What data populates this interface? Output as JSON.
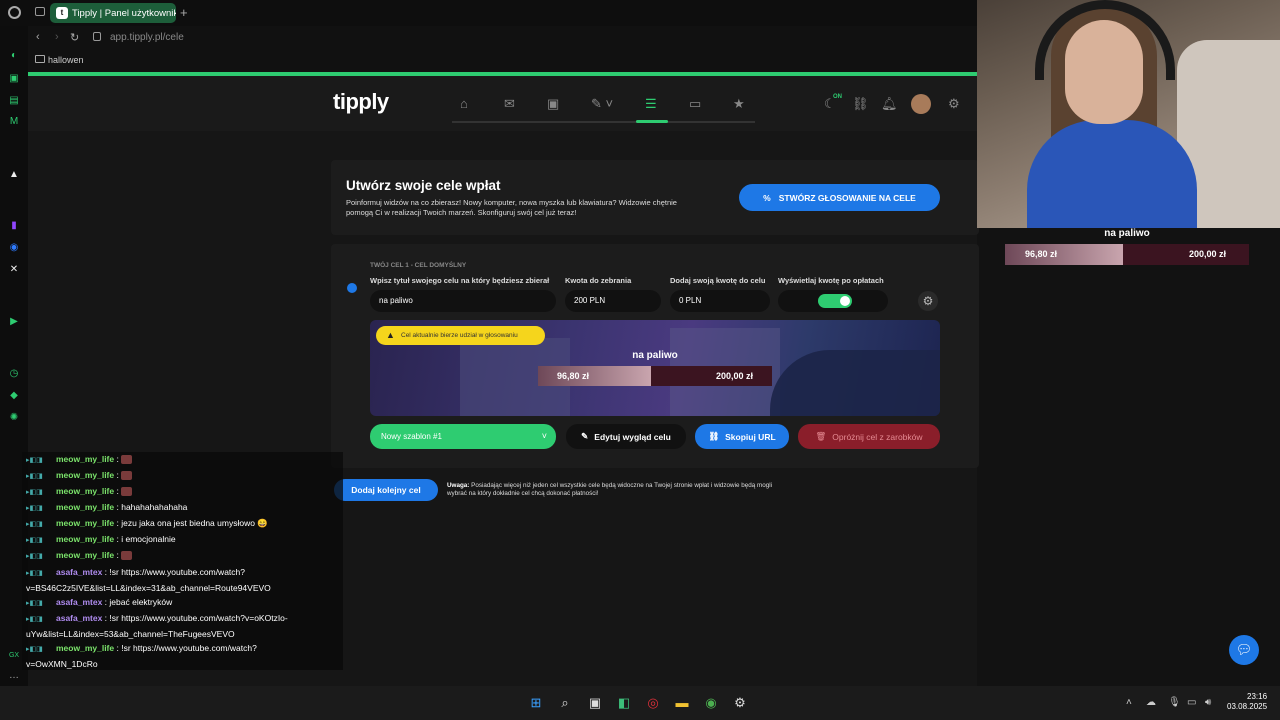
{
  "browser": {
    "tab_title": "Tipply | Panel użytkownika",
    "url": "app.tipply.pl/cele",
    "bookmark": "hallowen",
    "new_tab_icon": "plus-icon"
  },
  "app": {
    "logo": "tipply",
    "nav_icons": [
      "home-icon",
      "inbox-icon",
      "wallet-icon",
      "edit-icon",
      "goals-icon",
      "window-icon",
      "star-icon"
    ],
    "right_icons": [
      "moon-icon",
      "link-icon",
      "bell-icon",
      "avatar",
      "gear-icon"
    ],
    "on_badge": "ON"
  },
  "header": {
    "title": "Utwórz swoje cele wpłat",
    "description": "Poinformuj widzów na co zbierasz! Nowy komputer, nowa myszka lub klawiatura? Widzowie chętnie pomogą Ci w realizacji Twoich marzeń. Skonfiguruj swój cel już teraz!",
    "vote_button": "STWÓRZ GŁOSOWANIE NA CELE",
    "vote_icon": "%"
  },
  "goal": {
    "heading": "TWÓJ CEL 1 - CEL DOMYŚLNY",
    "labels": {
      "title": "Wpisz tytuł swojego celu na który będziesz zbierał",
      "amount": "Kwota do zebrania",
      "own": "Dodaj swoją kwotę do celu",
      "show": "Wyświetlaj kwotę po opłatach"
    },
    "values": {
      "title": "na paliwo",
      "amount": "200 PLN",
      "own": "0 PLN"
    },
    "toggle_on": true,
    "warning": "Cel aktualnie bierze udział w głosowaniu",
    "preview_title": "na paliwo",
    "current": "96,80 zł",
    "target": "200,00 zł",
    "progress_fraction": 0.484,
    "template": "Nowy szablon #1",
    "edit_button": "Edytuj wygląd celu",
    "copy_button": "Skopiuj URL",
    "clear_button": "Opróżnij cel z zarobków"
  },
  "add_goal_button": "Dodaj kolejny cel",
  "note_bold": "Uwaga:",
  "note_text": "Posiadając więcej niż jeden cel wszystkie cele będą widoczne na Twojej stronie wpłat i widzowie będą mogli wybrać na który dokładnie cel chcą dokonać płatności!",
  "webcam_overlay": {
    "title": "na paliwo",
    "current": "96,80 zł",
    "target": "200,00 zł"
  },
  "chat": [
    {
      "user": "meow_my_life",
      "color": "green",
      "text": "",
      "emote": true
    },
    {
      "user": "meow_my_life",
      "color": "green",
      "text": "",
      "emote": true
    },
    {
      "user": "meow_my_life",
      "color": "green",
      "text": "",
      "emote": true
    },
    {
      "user": "meow_my_life",
      "color": "green",
      "text": "hahahahahahaha"
    },
    {
      "user": "meow_my_life",
      "color": "green",
      "text": "jezu jaka ona jest biedna umysłowo 😄"
    },
    {
      "user": "meow_my_life",
      "color": "green",
      "text": "i emocjonalnie"
    },
    {
      "user": "meow_my_life",
      "color": "green",
      "text": "",
      "emote": true
    },
    {
      "user": "asafa_mtex",
      "color": "purple",
      "text": "!sr https://www.youtube.com/watch?v=BS46C2z5IVE&list=LL&index=31&ab_channel=Route94VEVO"
    },
    {
      "user": "asafa_mtex",
      "color": "purple",
      "text": "jebać elektryków"
    },
    {
      "user": "asafa_mtex",
      "color": "purple",
      "text": "!sr https://www.youtube.com/watch?v=oKOtzIo-uYw&list=LL&index=53&ab_channel=TheFugeesVEVO"
    },
    {
      "user": "meow_my_life",
      "color": "green",
      "text": "!sr https://www.youtube.com/watch?v=OwXMN_1DcRo"
    }
  ],
  "taskbar": {
    "time": "23:16",
    "date": "03.08.2025"
  }
}
